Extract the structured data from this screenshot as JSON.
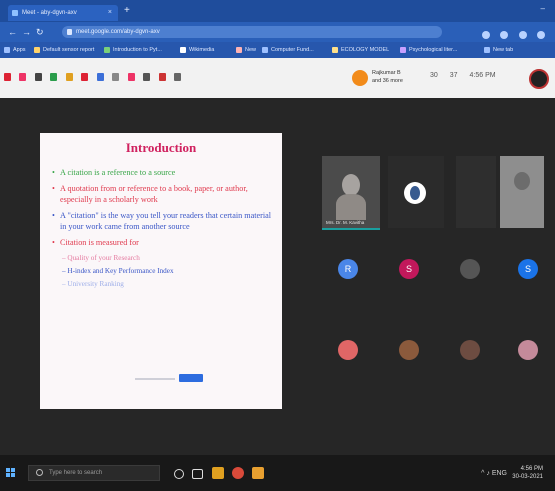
{
  "browser": {
    "tab_title": "Meet - aby-dgvn-axv",
    "tab_close": "×",
    "new_tab": "+",
    "window_controls": "–",
    "url": "meet.google.com/aby-dgvn-axv",
    "bookmarks": [
      "Apps",
      "Default sensor report",
      "Introduction to Pyt...",
      "Wikimedia",
      "New",
      "Computer Fund...",
      "ECOLOGY MODEL",
      "Psychological liter...",
      "New tab"
    ]
  },
  "meet": {
    "presenter_name": "Rajkumar B",
    "presenter_sub": "and 36 more",
    "right_stats": [
      "30",
      "37",
      "4:56 PM"
    ],
    "slide": {
      "title": "Introduction",
      "bullets": [
        {
          "text": "A citation is a reference to a source",
          "color": "green"
        },
        {
          "text": "A quotation from or reference to a book, paper, or author, especially in a scholarly work",
          "color": "red"
        },
        {
          "text": "A \"citation\" is the way you tell your readers that certain material in your work came from another source",
          "color": "blue"
        },
        {
          "text": "Citation is measured for",
          "color": "red"
        }
      ],
      "subbullets": [
        {
          "text": "– Quality of your Research",
          "color": "pink"
        },
        {
          "text": "– H-index and Key Performance Index",
          "color": "blue"
        },
        {
          "text": "– University Ranking",
          "color": "faded"
        }
      ]
    },
    "self_tile_label": "Mrs. Dr. M. Kavitha",
    "participants": [
      {
        "initial": "R",
        "color": "#4a86e8"
      },
      {
        "initial": "S",
        "color": "#c2185b"
      },
      {
        "initial": "",
        "color": "#555555"
      },
      {
        "initial": "S",
        "color": "#1a73e8"
      },
      {
        "initial": "",
        "color": "#e06666"
      },
      {
        "initial": "",
        "color": "#8b5a3c"
      },
      {
        "initial": "",
        "color": "#6d4c41"
      },
      {
        "initial": "",
        "color": "#c48a9a"
      }
    ]
  },
  "taskbar": {
    "search_placeholder": "Type here to search",
    "time": "4:56 PM",
    "date": "30-03-2021",
    "tray_glyphs": "^ ♪ ENG"
  }
}
